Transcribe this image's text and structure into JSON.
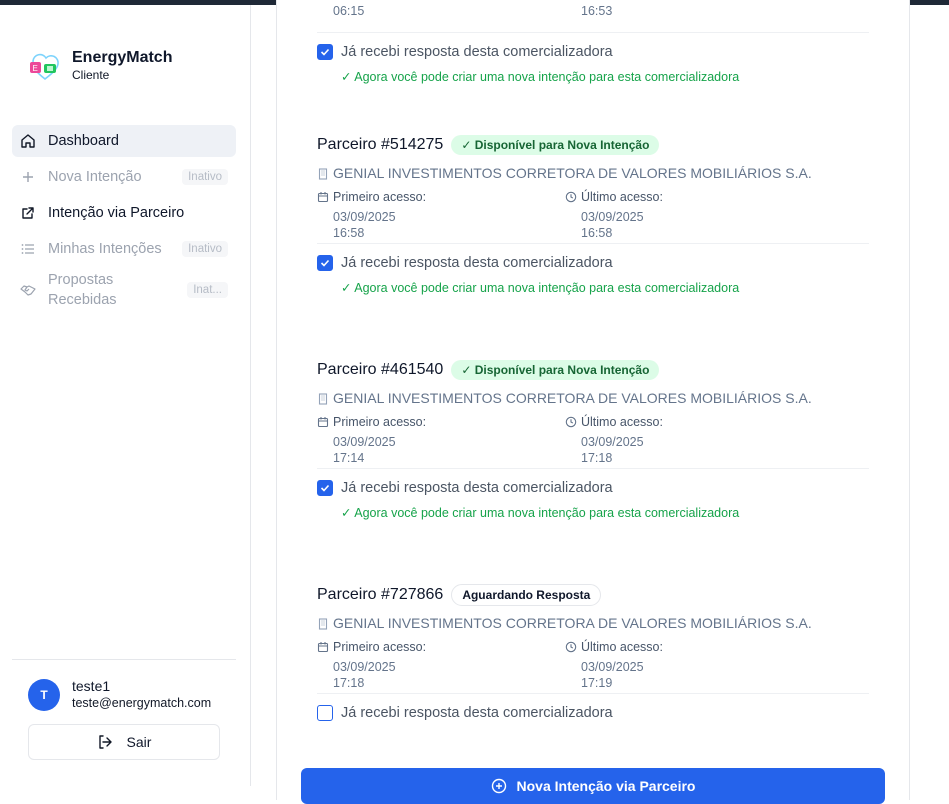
{
  "app": {
    "name": "EnergyMatch",
    "role": "Cliente"
  },
  "sidebar": {
    "items": [
      {
        "label": "Dashboard",
        "icon": "home-icon",
        "active": true
      },
      {
        "label": "Nova Intenção",
        "icon": "plus-icon",
        "badge": "Inativo"
      },
      {
        "label": "Intenção via Parceiro",
        "icon": "external-link-icon"
      },
      {
        "label": "Minhas Intenções",
        "icon": "list-icon",
        "badge": "Inativo"
      },
      {
        "label": "Propostas Recebidas",
        "icon": "handshake-icon",
        "badge": "Inat..."
      }
    ]
  },
  "user": {
    "initial": "T",
    "name": "teste1",
    "email": "teste@energymatch.com",
    "logout_label": "Sair"
  },
  "top_fragment": {
    "first_time": "06:15",
    "last_time": "16:53",
    "checkbox_label": "Já recebi resposta desta comercializadora",
    "note": "✓ Agora você pode criar uma nova intenção para esta comercializadora"
  },
  "partners": [
    {
      "title": "Parceiro #514275",
      "status": "✓ Disponível para Nova Intenção",
      "company": "GENIAL INVESTIMENTOS CORRETORA DE VALORES MOBILIÁRIOS S.A.",
      "first_label": "Primeiro acesso:",
      "first_date": "03/09/2025",
      "first_time": "16:58",
      "last_label": "Último acesso:",
      "last_date": "03/09/2025",
      "last_time": "16:58",
      "checkbox_label": "Já recebi resposta desta comercializadora",
      "checked": true,
      "note": "✓ Agora você pode criar uma nova intenção para esta comercializadora"
    },
    {
      "title": "Parceiro #461540",
      "status": "✓ Disponível para Nova Intenção",
      "company": "GENIAL INVESTIMENTOS CORRETORA DE VALORES MOBILIÁRIOS S.A.",
      "first_label": "Primeiro acesso:",
      "first_date": "03/09/2025",
      "first_time": "17:14",
      "last_label": "Último acesso:",
      "last_date": "03/09/2025",
      "last_time": "17:18",
      "checkbox_label": "Já recebi resposta desta comercializadora",
      "checked": true,
      "note": "✓ Agora você pode criar uma nova intenção para esta comercializadora"
    },
    {
      "title": "Parceiro #727866",
      "status": "Aguardando Resposta",
      "company": "GENIAL INVESTIMENTOS CORRETORA DE VALORES MOBILIÁRIOS S.A.",
      "first_label": "Primeiro acesso:",
      "first_date": "03/09/2025",
      "first_time": "17:18",
      "last_label": "Último acesso:",
      "last_date": "03/09/2025",
      "last_time": "17:19",
      "checkbox_label": "Já recebi resposta desta comercializadora",
      "checked": false
    }
  ],
  "cta": {
    "label": "Nova Intenção via Parceiro"
  },
  "colors": {
    "primary": "#2563eb",
    "success": "#16a34a",
    "success_bg": "#dcfce7"
  }
}
